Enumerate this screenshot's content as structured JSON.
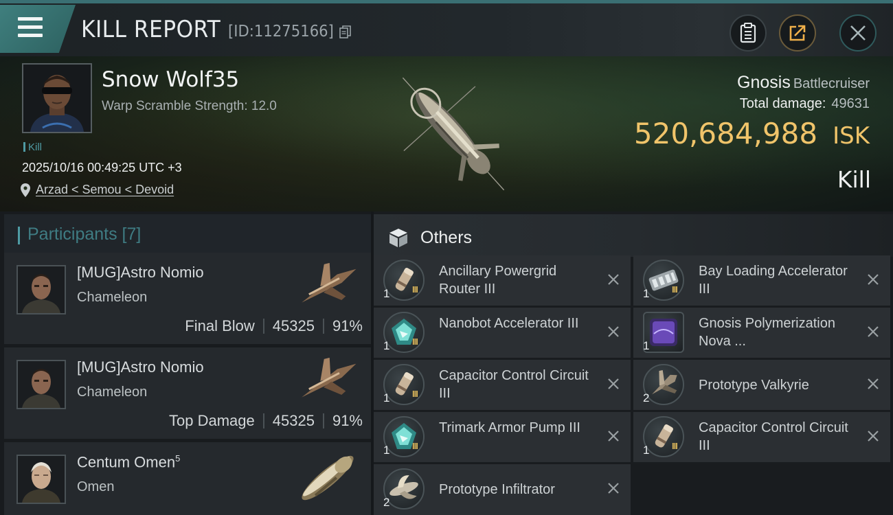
{
  "header": {
    "title": "KILL REPORT",
    "id_text": "[ID:11275166]"
  },
  "victim": {
    "name": "Snow Wolf35",
    "warp_text": "Warp Scramble Strength: 12.0",
    "tag": "Kill",
    "datetime": "2025/10/16 00:49:25 UTC +3",
    "location": "Arzad < Semou < Devoid"
  },
  "ship": {
    "name": "Gnosis",
    "type": "Battlecruiser",
    "total_damage_label": "Total damage:",
    "total_damage": "49631",
    "isk_value": "520,684,988",
    "isk_unit": "ISK",
    "result": "Kill"
  },
  "participants": {
    "title": "Participants [7]",
    "items": [
      {
        "name": "[MUG]Astro Nomio",
        "level": "",
        "ship": "Chameleon",
        "role": "Final Blow",
        "damage": "45325",
        "percent": "91%"
      },
      {
        "name": "[MUG]Astro Nomio",
        "level": "",
        "ship": "Chameleon",
        "role": "Top Damage",
        "damage": "45325",
        "percent": "91%"
      },
      {
        "name": "Centum Omen",
        "level": "5",
        "ship": "Omen",
        "role": "",
        "damage": "",
        "percent": ""
      }
    ]
  },
  "others": {
    "title": "Others",
    "items": [
      {
        "name": "Ancillary Powergrid Router III",
        "qty": "1",
        "tier": "III",
        "icon": "capacitor-module-icon"
      },
      {
        "name": "Bay Loading Accelerator III",
        "qty": "1",
        "tier": "III",
        "icon": "launcher-rig-icon"
      },
      {
        "name": "Nanobot Accelerator III",
        "qty": "1",
        "tier": "III",
        "icon": "armor-rig-icon"
      },
      {
        "name": "Gnosis Polymerization Nova ...",
        "qty": "1",
        "tier": "",
        "icon": "ship-skin-icon"
      },
      {
        "name": "Capacitor Control Circuit III",
        "qty": "1",
        "tier": "III",
        "icon": "capacitor-module-icon"
      },
      {
        "name": "Prototype  Valkyrie",
        "qty": "2",
        "tier": "",
        "icon": "drone-icon"
      },
      {
        "name": "Trimark Armor Pump III",
        "qty": "1",
        "tier": "III",
        "icon": "armor-rig-icon"
      },
      {
        "name": "Capacitor Control Circuit III",
        "qty": "1",
        "tier": "III",
        "icon": "capacitor-module-icon"
      },
      {
        "name": "Prototype  Infiltrator",
        "qty": "2",
        "tier": "",
        "icon": "drone-icon"
      }
    ]
  },
  "colors": {
    "accent_teal": "#3f7f7e",
    "isk_gold": "#f0c46a",
    "background": "#15181b"
  }
}
